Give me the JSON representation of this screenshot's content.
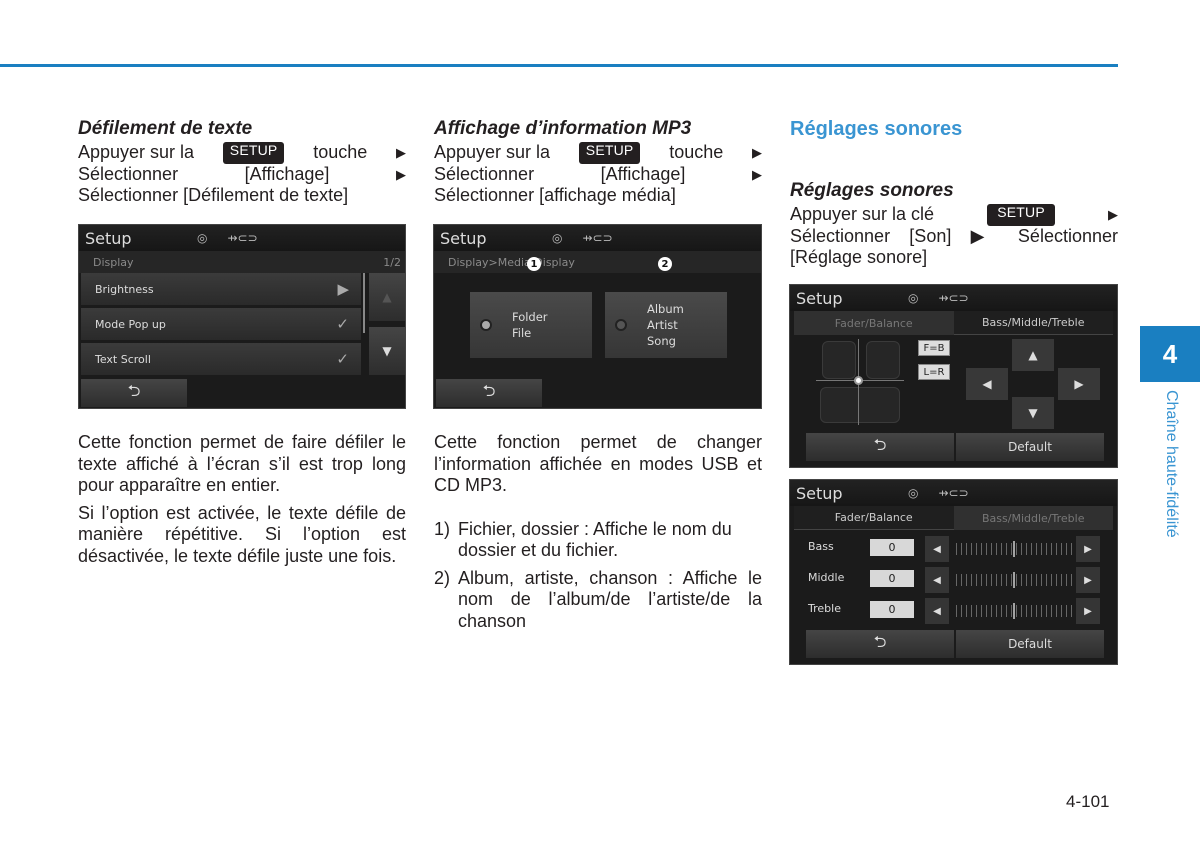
{
  "colors": {
    "accent": "#1a7fc1",
    "heading_blue": "#3a95d2"
  },
  "page": {
    "number": "4-101",
    "chapter_number": "4",
    "chapter_title": "Chaîne haute-fidélité"
  },
  "col1": {
    "heading": "Défilement de texte",
    "line1_a": "Appuyer sur la",
    "key": "SETUP",
    "line1_b": "touche",
    "line2_a": "Sélectionner",
    "line2_b": "[Affichage]",
    "line3": "Sélectionner [Défilement de texte]",
    "screen": {
      "title": "Setup",
      "subtitle": "Display",
      "page": "1/2",
      "rows": [
        {
          "label": "Brightness",
          "state": "arrow"
        },
        {
          "label": "Mode Pop up",
          "state": "checked"
        },
        {
          "label": "Text Scroll",
          "state": "checked"
        }
      ],
      "back_icon": "⮌"
    },
    "para1": "Cette fonction permet de faire défiler le texte affiché à l’écran s’il est trop long pour apparaître en entier.",
    "para2": "Si l’option est activée, le texte défile de manière répétitive. Si l’option est désactivée, le texte défile juste une fois."
  },
  "col2": {
    "heading": "Affichage d’information MP3",
    "line1_a": "Appuyer sur la",
    "key": "SETUP",
    "line1_b": "touche",
    "line2_a": "Sélectionner",
    "line2_b": "[Affichage]",
    "line3": "Sélectionner [affichage média]",
    "screen": {
      "title": "Setup",
      "breadcrumb": "Display>Media Display",
      "badge1": "1",
      "badge2": "2",
      "option1": "Folder\nFile",
      "option2": "Album\nArtist\nSong",
      "back_icon": "⮌"
    },
    "para1": "Cette fonction permet de changer l’information affichée en modes USB et CD MP3.",
    "list": [
      {
        "num": "1)",
        "text": "Fichier, dossier : Affiche le nom du dossier et du fichier."
      },
      {
        "num": "2)",
        "text": "Album, artiste, chanson : Affiche le nom de l’album/de l’artiste/de la chanson"
      }
    ]
  },
  "col3": {
    "section_title": "Réglages sonores",
    "heading": "Réglages sonores",
    "line1_a": "Appuyer sur la clé",
    "key": "SETUP",
    "line2": "Sélectionner [Son] ▶ Sélectionner",
    "line3": "[Réglage sonore]",
    "screen1": {
      "title": "Setup",
      "tab_a": "Fader/Balance",
      "tab_b": "Bass/Middle/Treble",
      "chip_fb": "F=B",
      "chip_lr": "L=R",
      "default": "Default",
      "back_icon": "⮌"
    },
    "screen2": {
      "title": "Setup",
      "tab_a": "Fader/Balance",
      "tab_b": "Bass/Middle/Treble",
      "rows": [
        {
          "label": "Bass",
          "value": "0",
          "level": 0.5
        },
        {
          "label": "Middle",
          "value": "0",
          "level": 0.5
        },
        {
          "label": "Treble",
          "value": "0",
          "level": 0.5
        }
      ],
      "default": "Default",
      "back_icon": "⮌"
    }
  }
}
